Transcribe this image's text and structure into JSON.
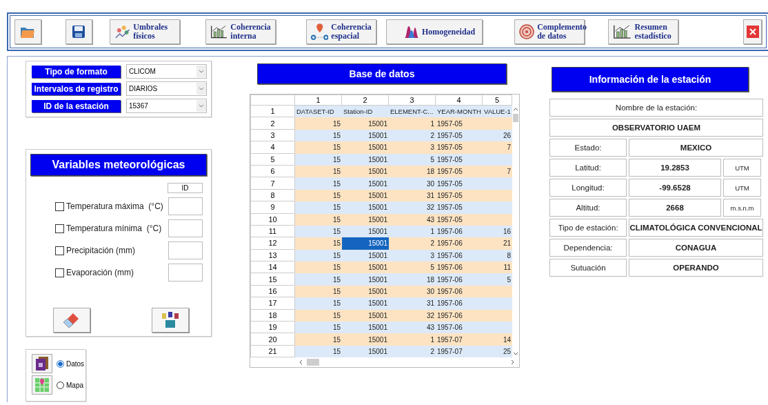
{
  "toolbar": [
    {
      "kind": "open"
    },
    {
      "kind": "save"
    },
    {
      "kind": "thresholds",
      "label": "Umbrales físicos"
    },
    {
      "kind": "internal",
      "label": "Coherencia interna"
    },
    {
      "kind": "spatial",
      "label": "Coherencia espacial"
    },
    {
      "kind": "homogeneity",
      "label": "Homogeneidad"
    },
    {
      "kind": "complement",
      "label": "Complemento de datos"
    },
    {
      "kind": "summary",
      "label": "Resumen estadístico"
    },
    {
      "kind": "close"
    }
  ],
  "format": [
    {
      "label": "Tipo de formato",
      "value": "CLICOM"
    },
    {
      "label": "Intervalos de registro",
      "value": "DIARIOS"
    },
    {
      "label": "ID de la estación",
      "value": "15367"
    }
  ],
  "variables": {
    "title": "Variables meteorológicas",
    "id_header": "ID",
    "items": [
      {
        "label": "Temperatura máxima  (°C)",
        "checked": false
      },
      {
        "label": "Temperatura mínima  (°C)",
        "checked": false
      },
      {
        "label": "Precipitación (mm)",
        "checked": false
      },
      {
        "label": "Evaporación (mm)",
        "checked": false
      }
    ]
  },
  "view": [
    {
      "kind": "data",
      "label": "Datos",
      "selected": true
    },
    {
      "kind": "map",
      "label": "Mapa",
      "selected": false
    }
  ],
  "database": {
    "title": "Base de datos",
    "columns": [
      "1",
      "2",
      "3",
      "4",
      "5"
    ],
    "rows": [
      {
        "header": "1",
        "kind": "names",
        "cells": [
          {
            "text": "DATASET-ID",
            "selected": false
          },
          {
            "text": "Station-ID",
            "selected": false
          },
          {
            "text": "ELEMENT-C...",
            "selected": false
          },
          {
            "text": "YEAR-MONTH",
            "selected": false
          },
          {
            "text": "VALUE-1",
            "selected": false
          }
        ]
      },
      {
        "header": "2",
        "kind": "data",
        "cells": [
          {
            "text": "15",
            "selected": false
          },
          {
            "text": "15001",
            "selected": false
          },
          {
            "text": "1",
            "selected": false
          },
          {
            "text": "1957-05",
            "selected": false
          },
          {
            "selected": false
          }
        ]
      },
      {
        "header": "3",
        "kind": "data",
        "cells": [
          {
            "text": "15",
            "selected": false
          },
          {
            "text": "15001",
            "selected": false
          },
          {
            "text": "2",
            "selected": false
          },
          {
            "text": "1957-05",
            "selected": false
          },
          {
            "text": "26",
            "selected": false
          }
        ]
      },
      {
        "header": "4",
        "kind": "data",
        "cells": [
          {
            "text": "15",
            "selected": false
          },
          {
            "text": "15001",
            "selected": false
          },
          {
            "text": "3",
            "selected": false
          },
          {
            "text": "1957-05",
            "selected": false
          },
          {
            "text": "7",
            "selected": false
          }
        ]
      },
      {
        "header": "5",
        "kind": "data",
        "cells": [
          {
            "text": "15",
            "selected": false
          },
          {
            "text": "15001",
            "selected": false
          },
          {
            "text": "5",
            "selected": false
          },
          {
            "text": "1957-05",
            "selected": false
          },
          {
            "selected": false
          }
        ]
      },
      {
        "header": "6",
        "kind": "data",
        "cells": [
          {
            "text": "15",
            "selected": false
          },
          {
            "text": "15001",
            "selected": false
          },
          {
            "text": "18",
            "selected": false
          },
          {
            "text": "1957-05",
            "selected": false
          },
          {
            "text": "7",
            "selected": false
          }
        ]
      },
      {
        "header": "7",
        "kind": "data",
        "cells": [
          {
            "text": "15",
            "selected": false
          },
          {
            "text": "15001",
            "selected": false
          },
          {
            "text": "30",
            "selected": false
          },
          {
            "text": "1957-05",
            "selected": false
          },
          {
            "selected": false
          }
        ]
      },
      {
        "header": "8",
        "kind": "data",
        "cells": [
          {
            "text": "15",
            "selected": false
          },
          {
            "text": "15001",
            "selected": false
          },
          {
            "text": "31",
            "selected": false
          },
          {
            "text": "1957-05",
            "selected": false
          },
          {
            "selected": false
          }
        ]
      },
      {
        "header": "9",
        "kind": "data",
        "cells": [
          {
            "text": "15",
            "selected": false
          },
          {
            "text": "15001",
            "selected": false
          },
          {
            "text": "32",
            "selected": false
          },
          {
            "text": "1957-05",
            "selected": false
          },
          {
            "selected": false
          }
        ]
      },
      {
        "header": "10",
        "kind": "data",
        "cells": [
          {
            "text": "15",
            "selected": false
          },
          {
            "text": "15001",
            "selected": false
          },
          {
            "text": "43",
            "selected": false
          },
          {
            "text": "1957-05",
            "selected": false
          },
          {
            "selected": false
          }
        ]
      },
      {
        "header": "11",
        "kind": "data",
        "cells": [
          {
            "text": "15",
            "selected": false
          },
          {
            "text": "15001",
            "selected": false
          },
          {
            "text": "1",
            "selected": false
          },
          {
            "text": "1957-06",
            "selected": false
          },
          {
            "text": "16",
            "selected": false
          }
        ]
      },
      {
        "header": "12",
        "kind": "data",
        "cells": [
          {
            "text": "15",
            "selected": false
          },
          {
            "text": "15001",
            "selected": true
          },
          {
            "text": "2",
            "selected": false
          },
          {
            "text": "1957-06",
            "selected": false
          },
          {
            "text": "21",
            "selected": false
          }
        ]
      },
      {
        "header": "13",
        "kind": "data",
        "cells": [
          {
            "text": "15",
            "selected": false
          },
          {
            "text": "15001",
            "selected": false
          },
          {
            "text": "3",
            "selected": false
          },
          {
            "text": "1957-06",
            "selected": false
          },
          {
            "text": "8",
            "selected": false
          }
        ]
      },
      {
        "header": "14",
        "kind": "data",
        "cells": [
          {
            "text": "15",
            "selected": false
          },
          {
            "text": "15001",
            "selected": false
          },
          {
            "text": "5",
            "selected": false
          },
          {
            "text": "1957-06",
            "selected": false
          },
          {
            "text": "11",
            "selected": false
          }
        ]
      },
      {
        "header": "15",
        "kind": "data",
        "cells": [
          {
            "text": "15",
            "selected": false
          },
          {
            "text": "15001",
            "selected": false
          },
          {
            "text": "18",
            "selected": false
          },
          {
            "text": "1957-06",
            "selected": false
          },
          {
            "text": "5",
            "selected": false
          }
        ]
      },
      {
        "header": "16",
        "kind": "data",
        "cells": [
          {
            "text": "15",
            "selected": false
          },
          {
            "text": "15001",
            "selected": false
          },
          {
            "text": "30",
            "selected": false
          },
          {
            "text": "1957-06",
            "selected": false
          },
          {
            "selected": false
          }
        ]
      },
      {
        "header": "17",
        "kind": "data",
        "cells": [
          {
            "text": "15",
            "selected": false
          },
          {
            "text": "15001",
            "selected": false
          },
          {
            "text": "31",
            "selected": false
          },
          {
            "text": "1957-06",
            "selected": false
          },
          {
            "selected": false
          }
        ]
      },
      {
        "header": "18",
        "kind": "data",
        "cells": [
          {
            "text": "15",
            "selected": false
          },
          {
            "text": "15001",
            "selected": false
          },
          {
            "text": "32",
            "selected": false
          },
          {
            "text": "1957-06",
            "selected": false
          },
          {
            "selected": false
          }
        ]
      },
      {
        "header": "19",
        "kind": "data",
        "cells": [
          {
            "text": "15",
            "selected": false
          },
          {
            "text": "15001",
            "selected": false
          },
          {
            "text": "43",
            "selected": false
          },
          {
            "text": "1957-06",
            "selected": false
          },
          {
            "selected": false
          }
        ]
      },
      {
        "header": "20",
        "kind": "data",
        "cells": [
          {
            "text": "15",
            "selected": false
          },
          {
            "text": "15001",
            "selected": false
          },
          {
            "text": "1",
            "selected": false
          },
          {
            "text": "1957-07",
            "selected": false
          },
          {
            "text": "14",
            "selected": false
          }
        ]
      },
      {
        "header": "21",
        "kind": "data",
        "cells": [
          {
            "text": "15",
            "selected": false
          },
          {
            "text": "15001",
            "selected": false
          },
          {
            "text": "2",
            "selected": false
          },
          {
            "text": "1957-07",
            "selected": false
          },
          {
            "text": "25",
            "selected": false
          }
        ]
      }
    ]
  },
  "station": {
    "title": "Información de la estación",
    "rows": [
      {
        "kind": "full",
        "text": "Nombre de la estación:"
      },
      {
        "kind": "name",
        "text": "OBSERVATORIO UAEM"
      },
      {
        "kind": "pair",
        "label": "Estado:",
        "value": "MEXICO"
      },
      {
        "kind": "unit",
        "label": "Latitud:",
        "value": "19.2853",
        "unit": "UTM"
      },
      {
        "kind": "unit",
        "label": "Longitud:",
        "value": "-99.6528",
        "unit": "UTM"
      },
      {
        "kind": "unit",
        "label": "Altitud:",
        "value": "2668",
        "unit": "m.s.n.m"
      },
      {
        "kind": "pair",
        "label": "Tipo de estación:",
        "value": "CLIMATOLÓGICA CONVENCIONAL"
      },
      {
        "kind": "pair",
        "label": "Dependencia:",
        "value": "CONAGUA"
      },
      {
        "kind": "pair",
        "label": "Sutuación",
        "value": "OPERANDO"
      }
    ]
  }
}
